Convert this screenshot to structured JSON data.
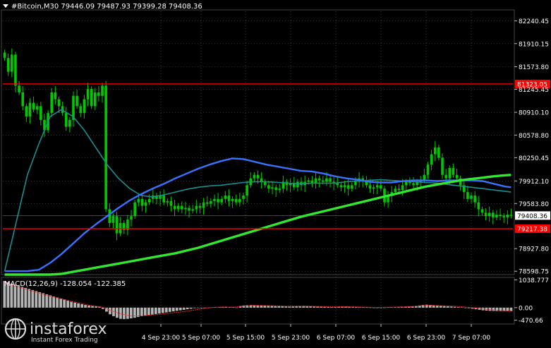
{
  "header": {
    "title": "#Bitcoin,M30 79446.09 79487.93 79399.28 79408.36"
  },
  "indicator": {
    "label": "MACD(12,26,9) -128.054 -122.385"
  },
  "watermark": {
    "brand": "instaforex",
    "tagline": "Instant Forex Trading"
  },
  "colors": {
    "background": "#000000",
    "candle": "#00c800",
    "grid": "#5a5a5a",
    "axis_text": "#ffffff",
    "level_line": "#ff0000",
    "ma_fast": "#3a72ff",
    "ma_mid": "#1b8f8f",
    "ma_slow": "#32e632",
    "macd_hist": "#b4b4b4",
    "signal": "#ff2020"
  },
  "chart_data": [
    {
      "type": "candlestick",
      "symbol": "#Bitcoin",
      "timeframe": "M30",
      "y_ticks": [
        "82240.45",
        "81910.15",
        "81573.80",
        "81245.45",
        "80910.10",
        "80578.80",
        "80250.45",
        "79912.10",
        "79583.80",
        "78927.80",
        "78598.75"
      ],
      "ylim": [
        78560,
        82380
      ],
      "x_ticks": [
        "4 Sep 23:00",
        "5 Sep 07:00",
        "5 Sep 15:00",
        "5 Sep 23:00",
        "6 Sep 07:00",
        "6 Sep 15:00",
        "6 Sep 23:00",
        "7 Sep 07:00"
      ],
      "levels": [
        {
          "value": 81323.05,
          "label": "81323.05"
        },
        {
          "value": 79217.38,
          "label": "79217.38"
        }
      ],
      "current_price": {
        "value": 79408.36,
        "label": "79408.36"
      },
      "series": [
        {
          "type": "line",
          "x": [
            0,
            4,
            8,
            12,
            16,
            20,
            24,
            28,
            32,
            36,
            40,
            44,
            48,
            52,
            56,
            60,
            64,
            68,
            72,
            76,
            80,
            84,
            88,
            92,
            96,
            100,
            104,
            108,
            112,
            116,
            120,
            124,
            128,
            132,
            136,
            140,
            144,
            148,
            152,
            156,
            160,
            164,
            168,
            172,
            176,
            178
          ],
          "values": [
            78600,
            78600,
            78600,
            78620,
            78720,
            78850,
            79000,
            79150,
            79280,
            79400,
            79520,
            79630,
            79720,
            79800,
            79870,
            79950,
            80020,
            80090,
            80150,
            80200,
            80240,
            80230,
            80190,
            80150,
            80120,
            80090,
            80060,
            80050,
            80020,
            79980,
            79950,
            79930,
            79900,
            79890,
            79890,
            79910,
            79920,
            79920,
            79910,
            79920,
            79920,
            79920,
            79910,
            79870,
            79830,
            79820
          ]
        },
        {
          "type": "line",
          "x": [
            0,
            4,
            8,
            12,
            16,
            20,
            24,
            28,
            32,
            36,
            40,
            44,
            48,
            52,
            56,
            60,
            64,
            68,
            72,
            76,
            80,
            84,
            88,
            92,
            96,
            100,
            104,
            108,
            112,
            116,
            120,
            124,
            128,
            132,
            136,
            140,
            144,
            148,
            152,
            156,
            160,
            164,
            168,
            172,
            176,
            178
          ],
          "values": [
            78600,
            79300,
            80000,
            80450,
            80850,
            80950,
            80850,
            80650,
            80400,
            80150,
            79950,
            79800,
            79700,
            79680,
            79710,
            79750,
            79790,
            79820,
            79840,
            79850,
            79870,
            79890,
            79900,
            79900,
            79890,
            79880,
            79870,
            79880,
            79880,
            79880,
            79900,
            79910,
            79920,
            79930,
            79920,
            79910,
            79900,
            79890,
            79880,
            79860,
            79840,
            79820,
            79800,
            79780,
            79760,
            79750
          ]
        },
        {
          "type": "line",
          "x": [
            0,
            4,
            8,
            12,
            16,
            20,
            24,
            28,
            32,
            36,
            40,
            44,
            48,
            52,
            56,
            60,
            64,
            68,
            72,
            76,
            80,
            84,
            88,
            92,
            96,
            100,
            104,
            108,
            112,
            116,
            120,
            124,
            128,
            132,
            136,
            140,
            144,
            148,
            152,
            156,
            160,
            164,
            168,
            172,
            176,
            178
          ],
          "values": [
            78550,
            78550,
            78550,
            78550,
            78550,
            78560,
            78590,
            78620,
            78650,
            78680,
            78710,
            78740,
            78770,
            78800,
            78830,
            78860,
            78900,
            78940,
            78990,
            79040,
            79090,
            79140,
            79190,
            79240,
            79290,
            79340,
            79390,
            79430,
            79470,
            79510,
            79550,
            79590,
            79630,
            79670,
            79710,
            79750,
            79790,
            79830,
            79860,
            79890,
            79920,
            79940,
            79960,
            79980,
            79995,
            80000
          ]
        }
      ],
      "candles": {
        "x_start": 0,
        "close": [
          81700,
          81500,
          81750,
          81300,
          81200,
          81000,
          80850,
          81050,
          80950,
          81000,
          80800,
          80650,
          80900,
          81200,
          81100,
          81000,
          80900,
          80700,
          80800,
          81150,
          81000,
          80900,
          81100,
          81250,
          81000,
          81200,
          81150,
          81300,
          79500,
          79300,
          79400,
          79150,
          79300,
          79200,
          79350,
          79400,
          79600,
          79650,
          79550,
          79600,
          79650,
          79700,
          79650,
          79700,
          79600,
          79620,
          79550,
          79500,
          79550,
          79500,
          79520,
          79480,
          79500,
          79550,
          79520,
          79600,
          79580,
          79620,
          79650,
          79600,
          79650,
          79700,
          79620,
          79650,
          79600,
          79650,
          79700,
          79850,
          79950,
          80000,
          79950,
          79900,
          79850,
          79800,
          79820,
          79780,
          79800,
          79900,
          79850,
          79880,
          79820,
          79900,
          79850,
          79900,
          79920,
          79880,
          79950,
          79920,
          79900,
          79950,
          79900,
          79880,
          79850,
          79820,
          79850,
          79800,
          79850,
          79900,
          79950,
          79920,
          79850,
          79800,
          79820,
          79850,
          79800,
          79600,
          79700,
          79750,
          79800,
          79780,
          79850,
          79900,
          79880,
          79850,
          79900,
          79920,
          80000,
          80150,
          80300,
          80400,
          80250,
          80000,
          79950,
          80100,
          80000,
          79950,
          79850,
          79750,
          79650,
          79700,
          79600,
          79500,
          79450,
          79400,
          79450,
          79380,
          79420,
          79400,
          79380,
          79420,
          79408
        ]
      }
    },
    {
      "type": "bar",
      "name": "MACD(12,26,9)",
      "y_ticks": [
        "1038.777",
        "0.00",
        "-470.66"
      ],
      "ylim": [
        -560,
        1080
      ],
      "histogram": [
        1000,
        950,
        900,
        860,
        820,
        780,
        740,
        700,
        660,
        620,
        580,
        540,
        500,
        460,
        420,
        380,
        340,
        300,
        260,
        220,
        190,
        160,
        130,
        100,
        80,
        60,
        50,
        40,
        -50,
        -150,
        -250,
        -320,
        -380,
        -420,
        -430,
        -420,
        -400,
        -380,
        -350,
        -320,
        -300,
        -280,
        -260,
        -240,
        -220,
        -200,
        -180,
        -160,
        -140,
        -120,
        -100,
        -80,
        -60,
        -40,
        -20,
        -10,
        -5,
        0,
        5,
        10,
        15,
        20,
        25,
        30,
        20,
        10,
        5,
        60,
        80,
        90,
        95,
        90,
        85,
        80,
        75,
        70,
        65,
        60,
        55,
        50,
        45,
        40,
        45,
        50,
        55,
        60,
        55,
        50,
        45,
        40,
        35,
        30,
        25,
        20,
        25,
        30,
        35,
        40,
        35,
        30,
        25,
        20,
        15,
        10,
        5,
        0,
        -5,
        0,
        5,
        10,
        15,
        20,
        25,
        30,
        35,
        40,
        45,
        60,
        80,
        100,
        110,
        100,
        90,
        80,
        70,
        60,
        50,
        40,
        30,
        20,
        10,
        0,
        -20,
        -40,
        -60,
        -80,
        -100,
        -110,
        -120,
        -125,
        -128,
        -128,
        -128,
        -128,
        -128
      ],
      "signal": [
        900,
        880,
        850,
        820,
        780,
        740,
        700,
        660,
        620,
        580,
        540,
        500,
        460,
        430,
        400,
        370,
        340,
        310,
        280,
        250,
        220,
        190,
        160,
        130,
        100,
        80,
        60,
        40,
        20,
        -20,
        -70,
        -120,
        -170,
        -210,
        -250,
        -280,
        -300,
        -310,
        -310,
        -305,
        -300,
        -290,
        -280,
        -270,
        -260,
        -245,
        -230,
        -215,
        -200,
        -185,
        -170,
        -155,
        -140,
        -120,
        -100,
        -80,
        -60,
        -40,
        -20,
        -5,
        5,
        15,
        20,
        25,
        25,
        22,
        20,
        30,
        45,
        60,
        70,
        78,
        82,
        82,
        80,
        78,
        75,
        72,
        68,
        64,
        60,
        56,
        54,
        54,
        55,
        56,
        56,
        55,
        53,
        50,
        47,
        44,
        40,
        36,
        33,
        32,
        33,
        34,
        34,
        33,
        31,
        29,
        26,
        23,
        20,
        16,
        12,
        10,
        10,
        11,
        13,
        16,
        19,
        22,
        26,
        30,
        34,
        40,
        48,
        58,
        70,
        78,
        82,
        82,
        80,
        77,
        73,
        68,
        62,
        56,
        48,
        40,
        30,
        20,
        8,
        -5,
        -20,
        -35,
        -50,
        -65,
        -80,
        -92,
        -102,
        -110,
        -116,
        -120,
        -122
      ]
    }
  ]
}
